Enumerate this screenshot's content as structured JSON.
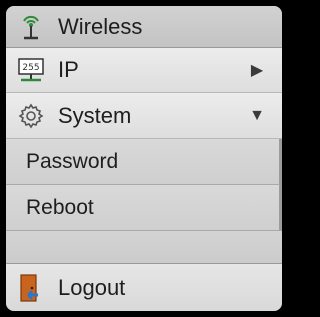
{
  "menu": {
    "wireless": {
      "label": "Wireless",
      "icon": "wireless-antenna-icon"
    },
    "ip": {
      "label": "IP",
      "icon": "network-255-icon",
      "arrow": "▶"
    },
    "system": {
      "label": "System",
      "icon": "gear-icon",
      "arrow": "▼",
      "expanded": true,
      "submenu": [
        {
          "label": "Password"
        },
        {
          "label": "Reboot"
        }
      ]
    },
    "logout": {
      "label": "Logout",
      "icon": "door-exit-icon"
    }
  },
  "colors": {
    "text": "#1e1e1e",
    "background": "#dcdcdc",
    "accent_green": "#2f8a3c",
    "door_orange": "#c8641e",
    "exit_blue": "#2c76c9"
  }
}
